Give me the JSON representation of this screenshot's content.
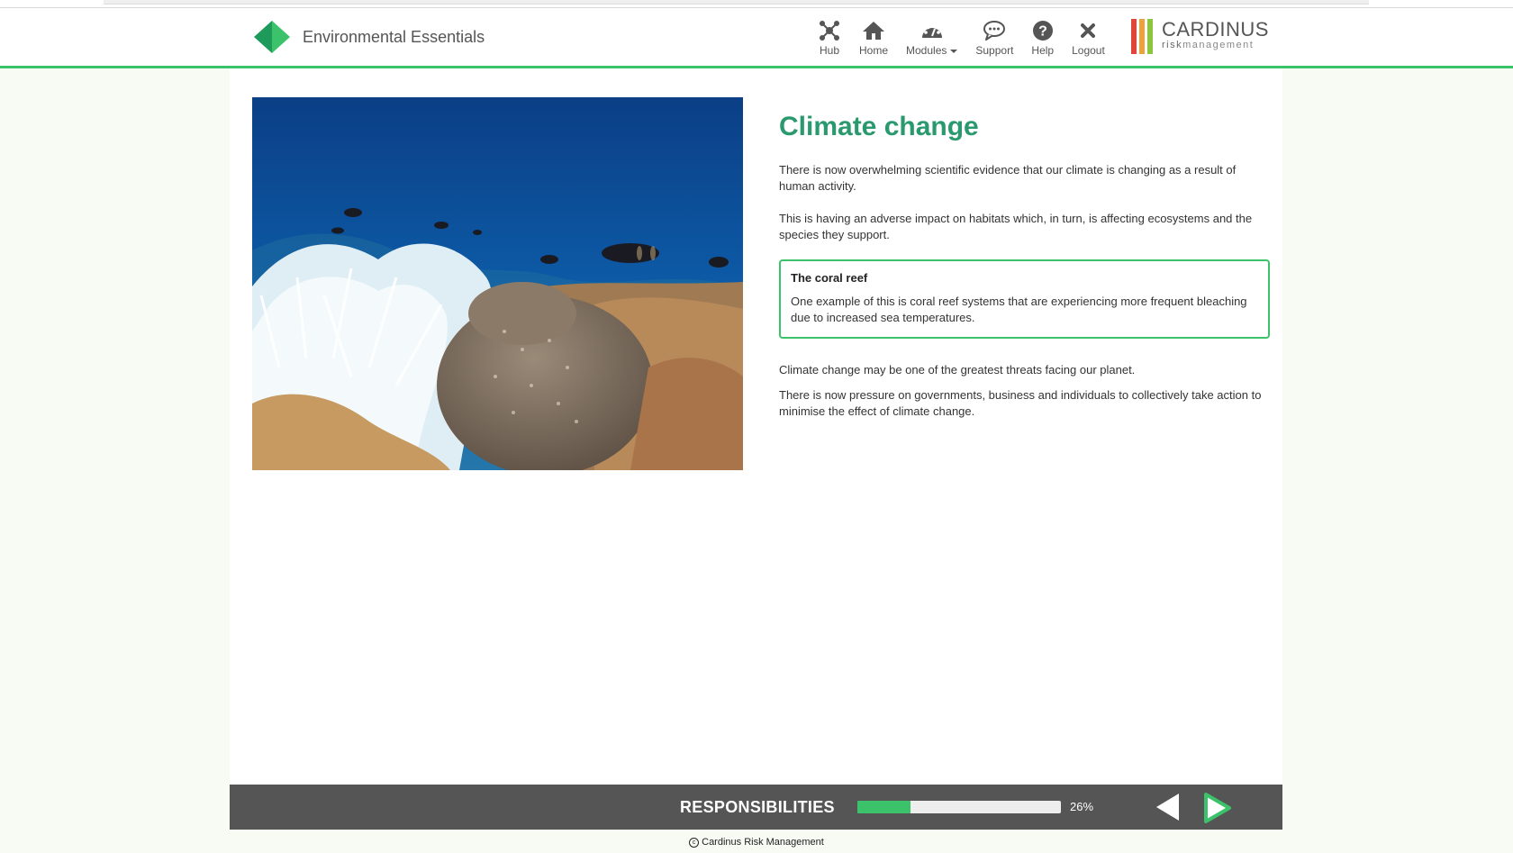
{
  "app": {
    "title": "Environmental Essentials",
    "brand_color": "#2fa867"
  },
  "nav": {
    "items": [
      {
        "label": "Hub",
        "icon": "hub-icon"
      },
      {
        "label": "Home",
        "icon": "home-icon"
      },
      {
        "label": "Modules",
        "icon": "dashboard-icon",
        "has_dropdown": true
      },
      {
        "label": "Support",
        "icon": "chat-bubble-icon"
      },
      {
        "label": "Help",
        "icon": "question-circle-icon"
      },
      {
        "label": "Logout",
        "icon": "close-icon"
      }
    ]
  },
  "logo": {
    "name": "CARDINUS",
    "sub_a": "risk",
    "sub_b": "management",
    "bar_colors": [
      "#e0463a",
      "#f0a23a",
      "#8cc63f"
    ]
  },
  "photo": {
    "subject": "coral reef with bleached white coral and fish"
  },
  "article": {
    "heading": "Climate change",
    "para1": "There is now overwhelming scientific evidence that our climate is changing as a result of human activity.",
    "para2": "This is having an adverse impact on habitats which, in turn, is affecting ecosystems and the species they support.",
    "callout": {
      "title": "The coral reef",
      "body": "One example of this is coral reef systems that are experiencing more frequent bleaching due to increased sea temperatures."
    },
    "para3": "Climate change may be one of the greatest threats facing our planet.",
    "para4": "There is now pressure on governments, business and individuals to collectively take action to minimise the effect of climate change."
  },
  "footer": {
    "section": "RESPONSIBILITIES",
    "progress_fraction": 0.26,
    "progress_text": "26%",
    "prev_icon": "arrow-left-icon",
    "next_icon": "arrow-right-icon",
    "accent": "#3cc26a"
  },
  "copyright": "Cardinus Risk Management"
}
